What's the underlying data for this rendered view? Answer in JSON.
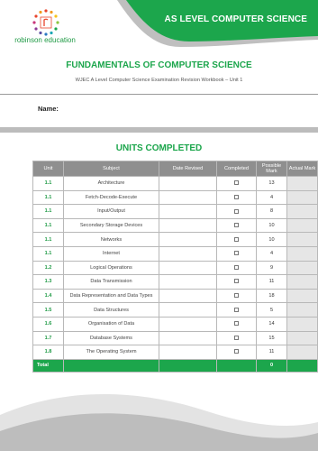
{
  "header": {
    "title": "AS LEVEL COMPUTER SCIENCE",
    "logo_icon": "robinson-education-logo",
    "logo_text": "robinson education"
  },
  "document": {
    "title": "FUNDAMENTALS OF COMPUTER SCIENCE",
    "subtitle": "WJEC A Level Computer Science Examination Revision Workbook – Unit 1",
    "name_label": "Name:",
    "units_heading": "UNITS COMPLETED"
  },
  "table": {
    "headers": {
      "unit": "Unit",
      "subject": "Subject",
      "date_revised": "Date Revised",
      "completed": "Completed",
      "possible_mark": "Possible Mark",
      "actual_mark": "Actual Mark"
    },
    "rows": [
      {
        "unit": "1.1",
        "subject": "Architecture",
        "possible_mark": "13"
      },
      {
        "unit": "1.1",
        "subject": "Fetch-Decode-Execute",
        "possible_mark": "4"
      },
      {
        "unit": "1.1",
        "subject": "Input/Output",
        "possible_mark": "8"
      },
      {
        "unit": "1.1",
        "subject": "Secondary Storage Devices",
        "possible_mark": "10"
      },
      {
        "unit": "1.1",
        "subject": "Networks",
        "possible_mark": "10"
      },
      {
        "unit": "1.1",
        "subject": "Internet",
        "possible_mark": "4"
      },
      {
        "unit": "1.2",
        "subject": "Logical Operations",
        "possible_mark": "9"
      },
      {
        "unit": "1.3",
        "subject": "Data Transmission",
        "possible_mark": "11"
      },
      {
        "unit": "1.4",
        "subject": "Data Representation and Data Types",
        "possible_mark": "18"
      },
      {
        "unit": "1.5",
        "subject": "Data Structures",
        "possible_mark": "5"
      },
      {
        "unit": "1.6",
        "subject": "Organisation of Data",
        "possible_mark": "14"
      },
      {
        "unit": "1.7",
        "subject": "Database Systems",
        "possible_mark": "15"
      },
      {
        "unit": "1.8",
        "subject": "The Operating System",
        "possible_mark": "11"
      }
    ],
    "total": {
      "label": "Total",
      "value": "0"
    }
  },
  "colors": {
    "brand_green": "#1ca64c",
    "header_gray": "#8f8f8f",
    "wave_gray": "#d0d0d0"
  }
}
